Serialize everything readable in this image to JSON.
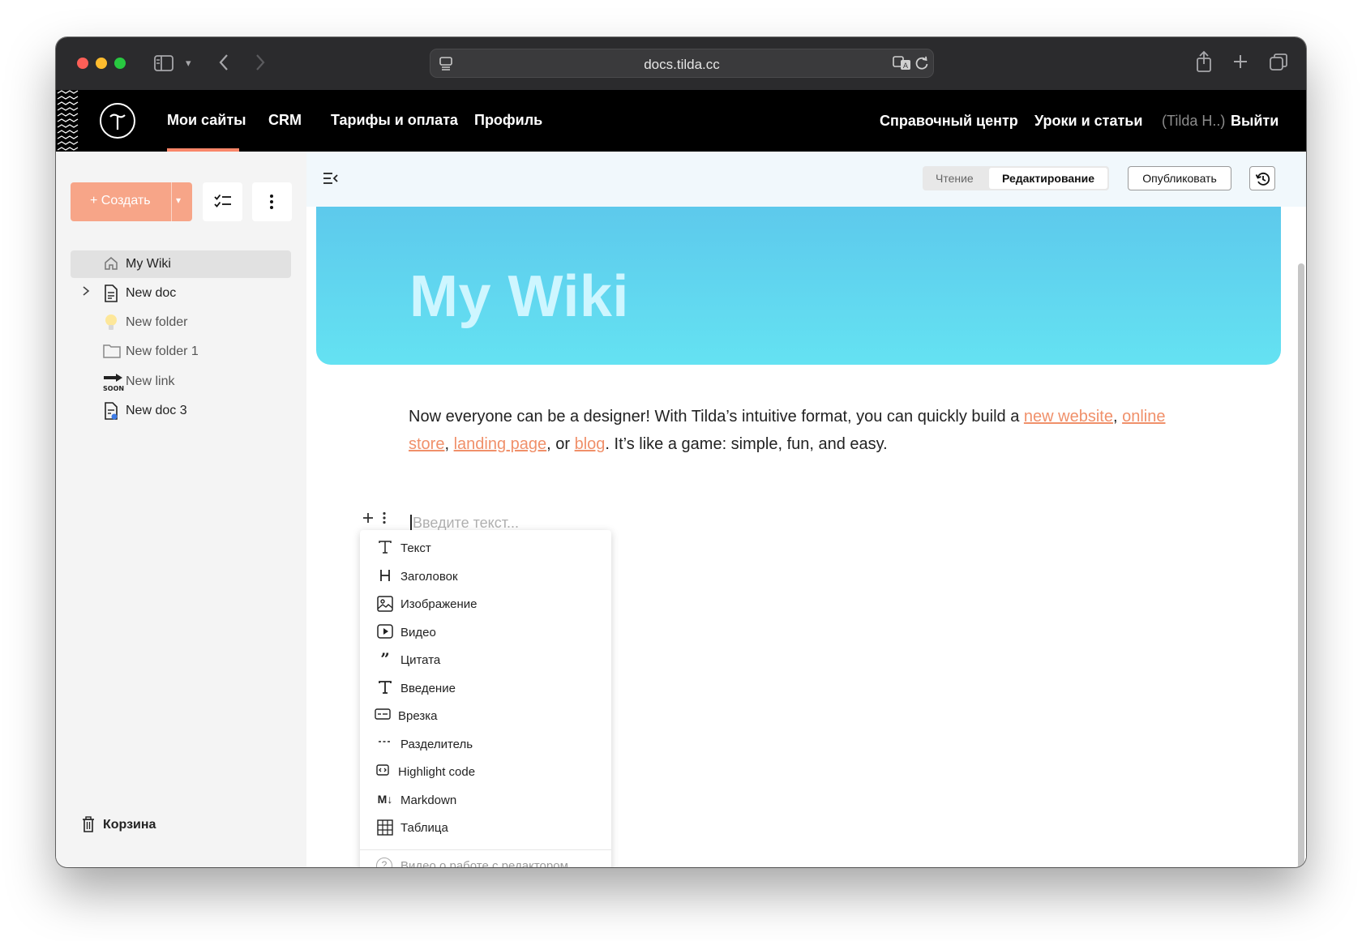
{
  "browser": {
    "url": "docs.tilda.cc"
  },
  "nav": {
    "items": [
      "Мои сайты",
      "CRM",
      "Тарифы и оплата",
      "Профиль"
    ],
    "right": [
      "Справочный центр",
      "Уроки и статьи"
    ],
    "user": "(Tilda H..)",
    "logout": "Выйти"
  },
  "sidebar": {
    "create_label": "+ Создать",
    "tree": [
      {
        "label": "My Wiki",
        "icon": "home-icon"
      },
      {
        "label": "New doc",
        "icon": "document-icon"
      },
      {
        "label": "New folder",
        "icon": "lightbulb-icon"
      },
      {
        "label": "New folder 1",
        "icon": "folder-icon"
      },
      {
        "label": "New link",
        "icon": "soon-link-icon"
      },
      {
        "label": "New doc 3",
        "icon": "document-dot-icon"
      }
    ],
    "trash_label": "Корзина"
  },
  "toolbar": {
    "read_label": "Чтение",
    "edit_label": "Редактирование",
    "publish_label": "Опубликовать"
  },
  "page": {
    "title": "My Wiki",
    "paragraph": {
      "p1": "Now everyone can be a designer! With Tilda’s intuitive format, you can quickly build a ",
      "link1": "new website",
      "sep1": ", ",
      "link2": "online store",
      "sep2": ", ",
      "link3": "landing page",
      "sep3": ", or ",
      "link4": "blog",
      "p2": ". It’s like a game: simple, fun, and easy."
    },
    "placeholder": "Введите текст..."
  },
  "block_menu": {
    "items": [
      {
        "label": "Текст",
        "icon": "text-icon"
      },
      {
        "label": "Заголовок",
        "icon": "heading-icon"
      },
      {
        "label": "Изображение",
        "icon": "image-icon"
      },
      {
        "label": "Видео",
        "icon": "video-icon"
      },
      {
        "label": "Цитата",
        "icon": "quote-icon"
      },
      {
        "label": "Введение",
        "icon": "intro-icon"
      },
      {
        "label": "Врезка",
        "icon": "callout-icon"
      },
      {
        "label": "Разделитель",
        "icon": "divider-icon"
      },
      {
        "label": "Highlight code",
        "icon": "code-icon"
      },
      {
        "label": "Markdown",
        "icon": "markdown-icon"
      },
      {
        "label": "Таблица",
        "icon": "table-icon"
      }
    ],
    "help_label": "Видео о работе с редактором"
  },
  "colors": {
    "accent": "#fa8669",
    "create_button": "#f7a588",
    "link": "#f0906a",
    "cover_top": "#5dc9ec",
    "cover_bottom": "#64e2f2"
  }
}
